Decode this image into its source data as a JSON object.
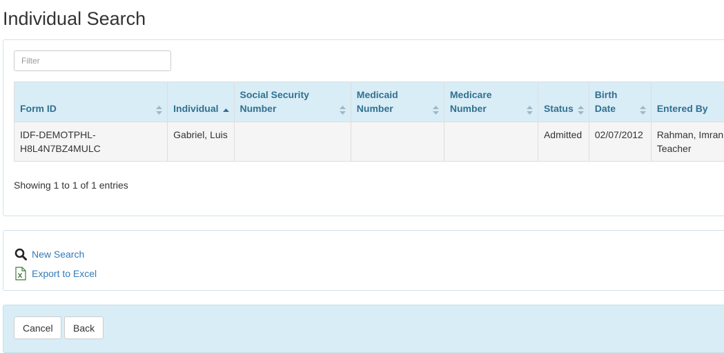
{
  "page": {
    "title": "Individual Search"
  },
  "filter": {
    "placeholder": "Filter",
    "value": ""
  },
  "table": {
    "columns": [
      {
        "label": "Form ID",
        "sort": "unsorted"
      },
      {
        "label": "Individual",
        "sort": "ascending"
      },
      {
        "label": "Social Security Number",
        "sort": "unsorted"
      },
      {
        "label": "Medicaid Number",
        "sort": "unsorted"
      },
      {
        "label": "Medicare Number",
        "sort": "unsorted"
      },
      {
        "label": "Status",
        "sort": "unsorted"
      },
      {
        "label": "Birth Date",
        "sort": "unsorted"
      },
      {
        "label": "Entered By",
        "sort": ""
      }
    ],
    "rows": [
      {
        "form_id": "IDF-DEMOTPHL-H8L4N7BZ4MULC",
        "individual": "Gabriel, Luis",
        "ssn": "",
        "medicaid": "",
        "medicare": "",
        "status": "Admitted",
        "birth_date": "02/07/2012",
        "entered_by": "Rahman, Imran Teacher"
      }
    ]
  },
  "info": {
    "showing": "Showing 1 to 1 of 1 entries"
  },
  "actions": {
    "new_search": "New Search",
    "export_excel": "Export to Excel"
  },
  "footer": {
    "cancel": "Cancel",
    "back": "Back"
  },
  "colors": {
    "header_bg": "#d9edf7",
    "header_text": "#31708f",
    "link": "#337ab7",
    "row_bg": "#f5f5f5"
  },
  "icons": {
    "new_search": "search-icon",
    "export_excel": "excel-file-icon",
    "sort_unsorted": "sort-both-icon",
    "sort_ascending": "sort-asc-icon"
  }
}
